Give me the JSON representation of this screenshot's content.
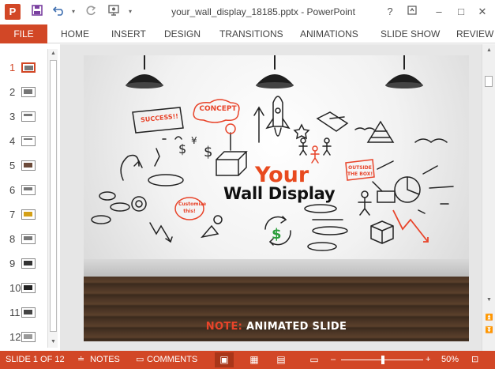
{
  "app": {
    "icon_letter": "P",
    "title": "your_wall_display_18185.pptx - PowerPoint"
  },
  "quick_access": {
    "save_icon": "save-icon",
    "undo_icon": "undo-icon",
    "redo_icon": "redo-icon",
    "present_icon": "present-from-start-icon",
    "customize_icon": "customize-qat-icon"
  },
  "window_controls": {
    "help": "?",
    "restore_options": "▣",
    "minimize": "–",
    "maximize": "□",
    "close": "✕"
  },
  "ribbon": {
    "file": "FILE",
    "tabs": [
      "HOME",
      "INSERT",
      "DESIGN",
      "TRANSITIONS",
      "ANIMATIONS",
      "SLIDE SHOW",
      "REVIEW"
    ]
  },
  "thumbnails": {
    "numbers": [
      "1",
      "2",
      "3",
      "4",
      "5",
      "6",
      "7",
      "8",
      "9",
      "10",
      "11",
      "12"
    ],
    "selected": "1"
  },
  "slide": {
    "heading_your": "Your",
    "heading_wall": "Wall Display",
    "doodle_success": "SUCCESS!!",
    "doodle_concept": "CONCEPT",
    "doodle_customize": "Customize this!",
    "doodle_outside_1": "OUTSIDE",
    "doodle_outside_2": "THE BOX!",
    "note_label": "NOTE:",
    "note_text": " ANIMATED SLIDE"
  },
  "status": {
    "slide_info": "SLIDE 1 OF 12",
    "notes": "NOTES",
    "comments": "COMMENTS",
    "zoom": "50%",
    "zoom_minus": "–",
    "zoom_plus": "+"
  },
  "colors": {
    "accent": "#d24726",
    "slide_orange": "#e8442a"
  }
}
